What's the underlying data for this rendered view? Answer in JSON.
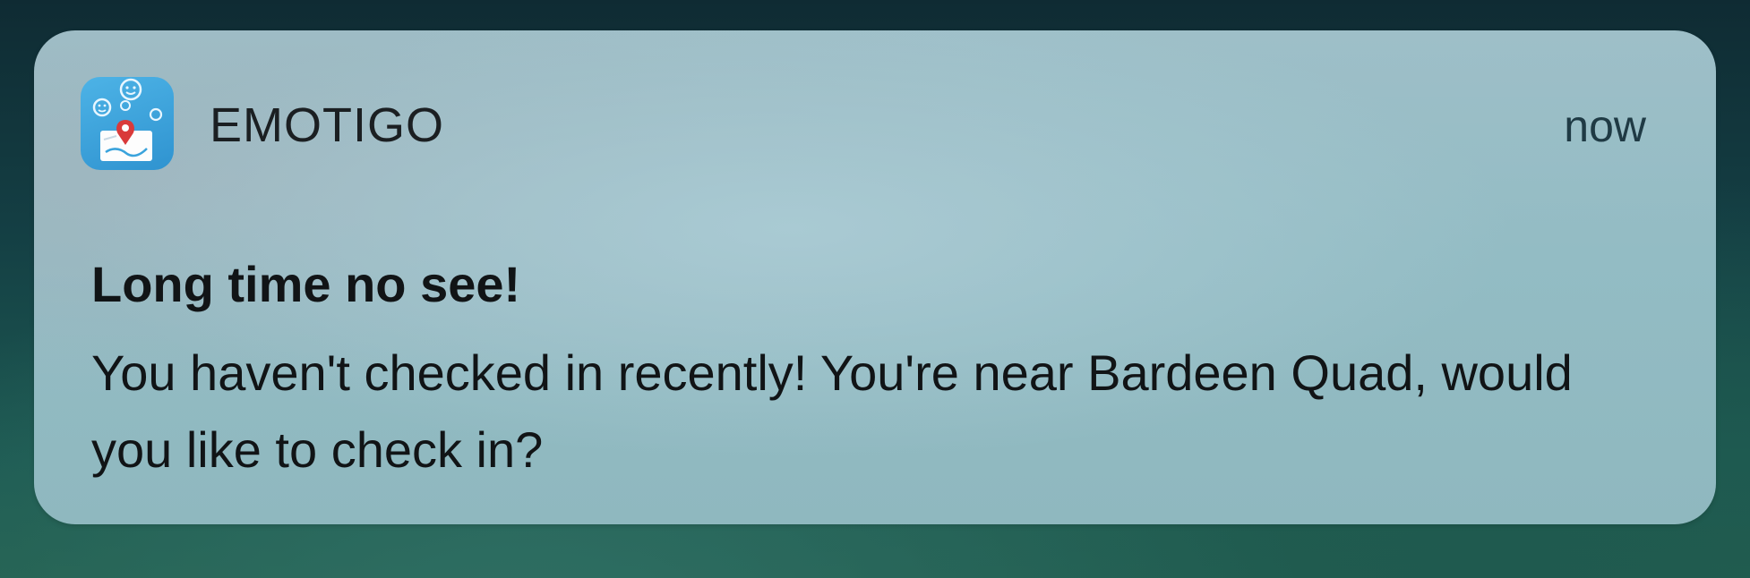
{
  "notification": {
    "app": {
      "name": "EMOTIGO",
      "icon": "emotigo-app-icon"
    },
    "timestamp": "now",
    "title": "Long time no see!",
    "body": "You haven't checked in recently! You're near Bardeen Quad, would you like to check in?"
  },
  "colors": {
    "app_icon_blue": "#3aa3dc",
    "pin_red": "#d93a3a",
    "text": "#111416"
  }
}
